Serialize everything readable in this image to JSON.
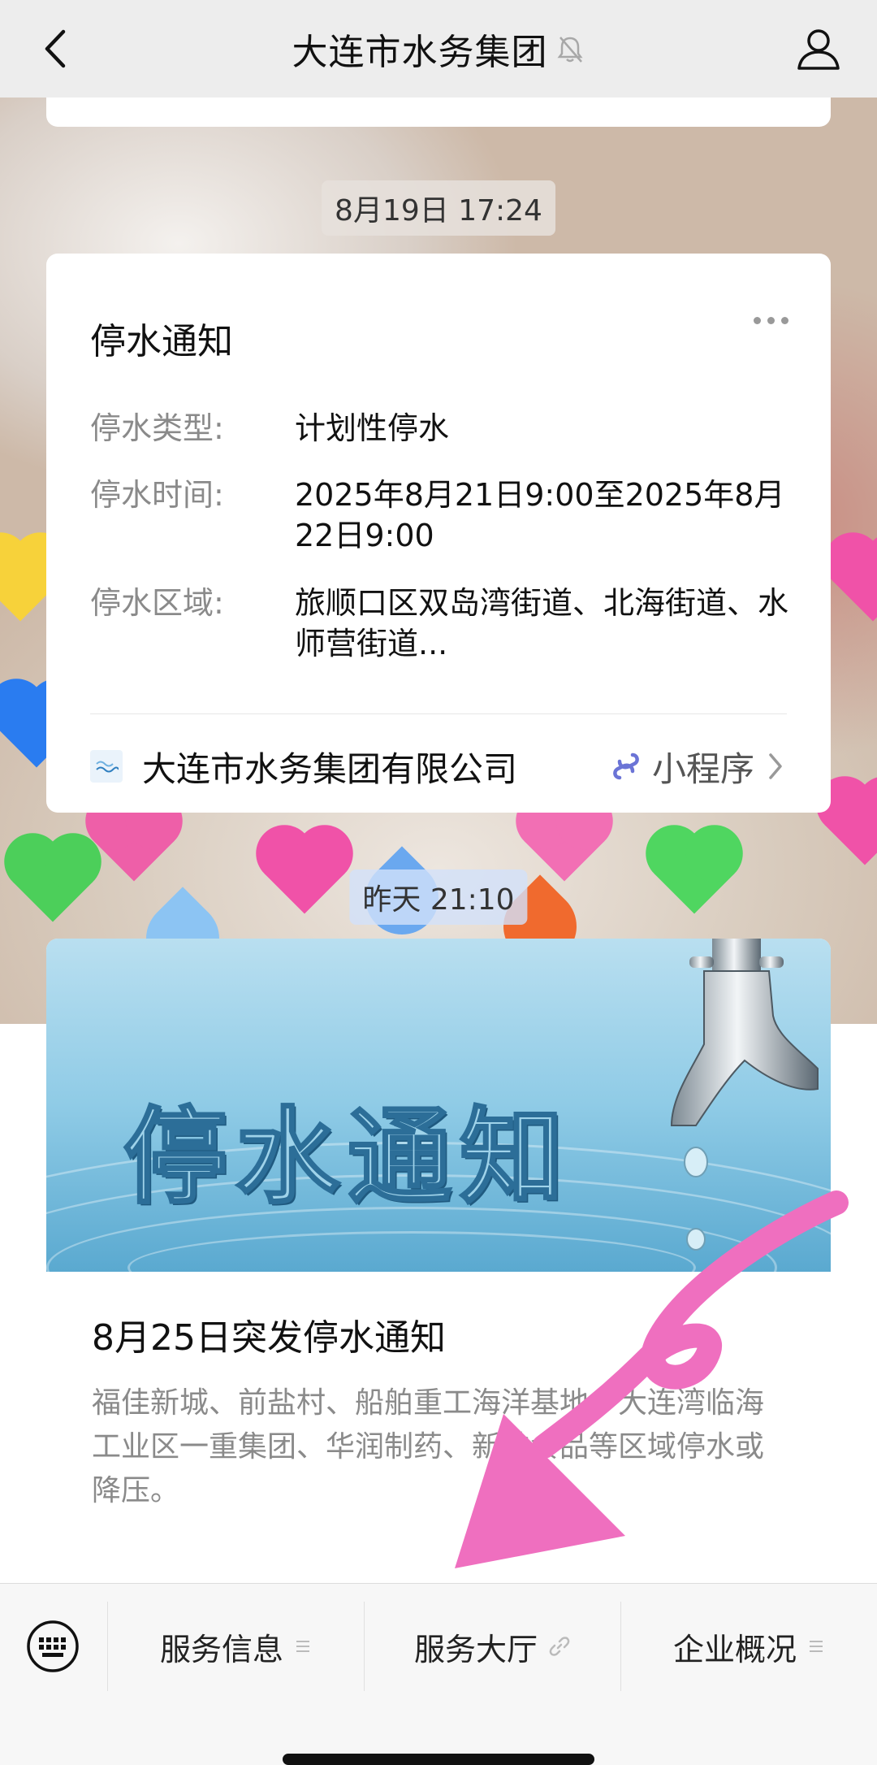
{
  "header": {
    "title": "大连市水务集团",
    "back_icon": "chevron-left-icon",
    "mute_icon": "bell-muted-icon",
    "profile_icon": "person-icon"
  },
  "messages": [
    {
      "timestamp": "8月19日 17:24",
      "card": {
        "title": "停水通知",
        "rows": [
          {
            "key": "停水类型:",
            "value": "计划性停水"
          },
          {
            "key": "停水时间:",
            "value": "2025年8月21日9:00至2025年8月22日9:00"
          },
          {
            "key": "停水区域:",
            "value": "旅顺口区双岛湾街道、北海街道、水师营街道..."
          }
        ],
        "org_name": "大连市水务集团有限公司",
        "mini_program_label": "小程序"
      }
    },
    {
      "timestamp": "昨天 21:10",
      "article": {
        "banner_text": "停水通知",
        "title": "8月25日突发停水通知",
        "description": "福佳新城、前盐村、船舶重工海洋基地、大连湾临海工业区一重集团、华润制药、新弛食品等区域停水或降压。"
      }
    }
  ],
  "menu": {
    "keyboard_icon": "keyboard-icon",
    "items": [
      {
        "label": "服务信息",
        "icon": "list-icon"
      },
      {
        "label": "服务大厅",
        "icon": "link-icon"
      },
      {
        "label": "企业概况",
        "icon": "list-icon"
      }
    ]
  },
  "colors": {
    "header_bg": "#ededed",
    "card_bg": "#ffffff",
    "mini_program_accent": "#6b74d6",
    "annotation_pink": "#ef6fbf"
  }
}
